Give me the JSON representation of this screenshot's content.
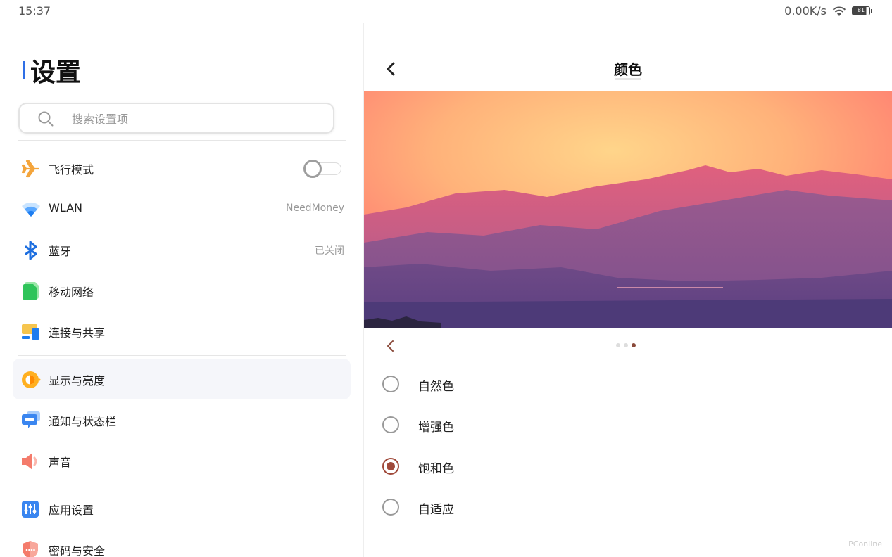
{
  "status_bar": {
    "time": "15:37",
    "network_speed": "0.00K/s",
    "battery_level": "81",
    "icons": [
      "wifi-icon",
      "battery-icon"
    ]
  },
  "sidebar": {
    "title": "设置",
    "search": {
      "placeholder": "搜索设置项",
      "value": ""
    },
    "items": [
      {
        "label": "飞行模式",
        "icon": "airplane-icon",
        "toggle": false
      },
      {
        "label": "WLAN",
        "icon": "wifi-icon",
        "value": "NeedMoney"
      },
      {
        "label": "蓝牙",
        "icon": "bluetooth-icon",
        "value": "已关闭"
      },
      {
        "label": "移动网络",
        "icon": "sim-card-icon"
      },
      {
        "label": "连接与共享",
        "icon": "connection-share-icon"
      },
      {
        "label": "显示与亮度",
        "icon": "brightness-icon",
        "selected": true
      },
      {
        "label": "通知与状态栏",
        "icon": "notification-icon"
      },
      {
        "label": "声音",
        "icon": "speaker-icon"
      },
      {
        "label": "应用设置",
        "icon": "app-settings-icon"
      },
      {
        "label": "密码与安全",
        "icon": "shield-icon"
      }
    ]
  },
  "detail": {
    "title": "颜色",
    "pager": {
      "total": 3,
      "current": 3
    },
    "color_modes": [
      {
        "label": "自然色",
        "checked": false
      },
      {
        "label": "增强色",
        "checked": false
      },
      {
        "label": "饱和色",
        "checked": true
      },
      {
        "label": "自适应",
        "checked": false
      }
    ],
    "accent_color": "#a0493a"
  },
  "watermark": "PConline"
}
